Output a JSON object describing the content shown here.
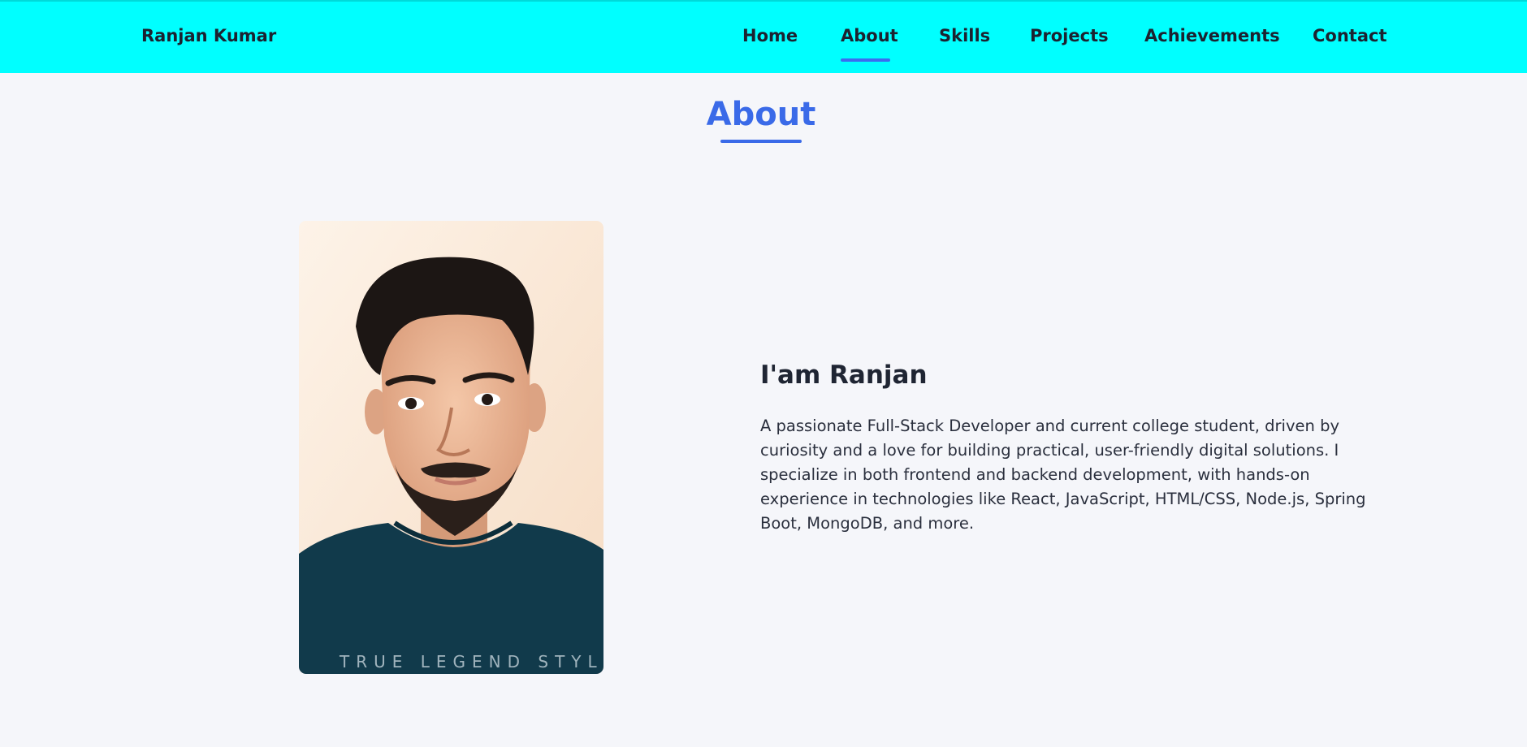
{
  "nav": {
    "brand": "Ranjan Kumar",
    "links": [
      "Home",
      "About",
      "Skills",
      "Projects",
      "Achievements",
      "Contact"
    ],
    "active": "About"
  },
  "about": {
    "title": "About",
    "heading": "I'am Ranjan",
    "paragraph": "A passionate Full-Stack Developer and current college student, driven by curiosity and a love for building practical, user-friendly digital solutions. I specialize in both frontend and backend development, with hands-on experience in technologies like React, JavaScript, HTML/CSS, Node.js, Spring Boot, MongoDB, and more.",
    "photo_shirt_text": "TRUE LEGEND STYLE"
  },
  "colors": {
    "navbar": "#00ffff",
    "accent": "#3a6ae8",
    "page_bg": "#f5f6fa",
    "text": "#1f2533"
  }
}
